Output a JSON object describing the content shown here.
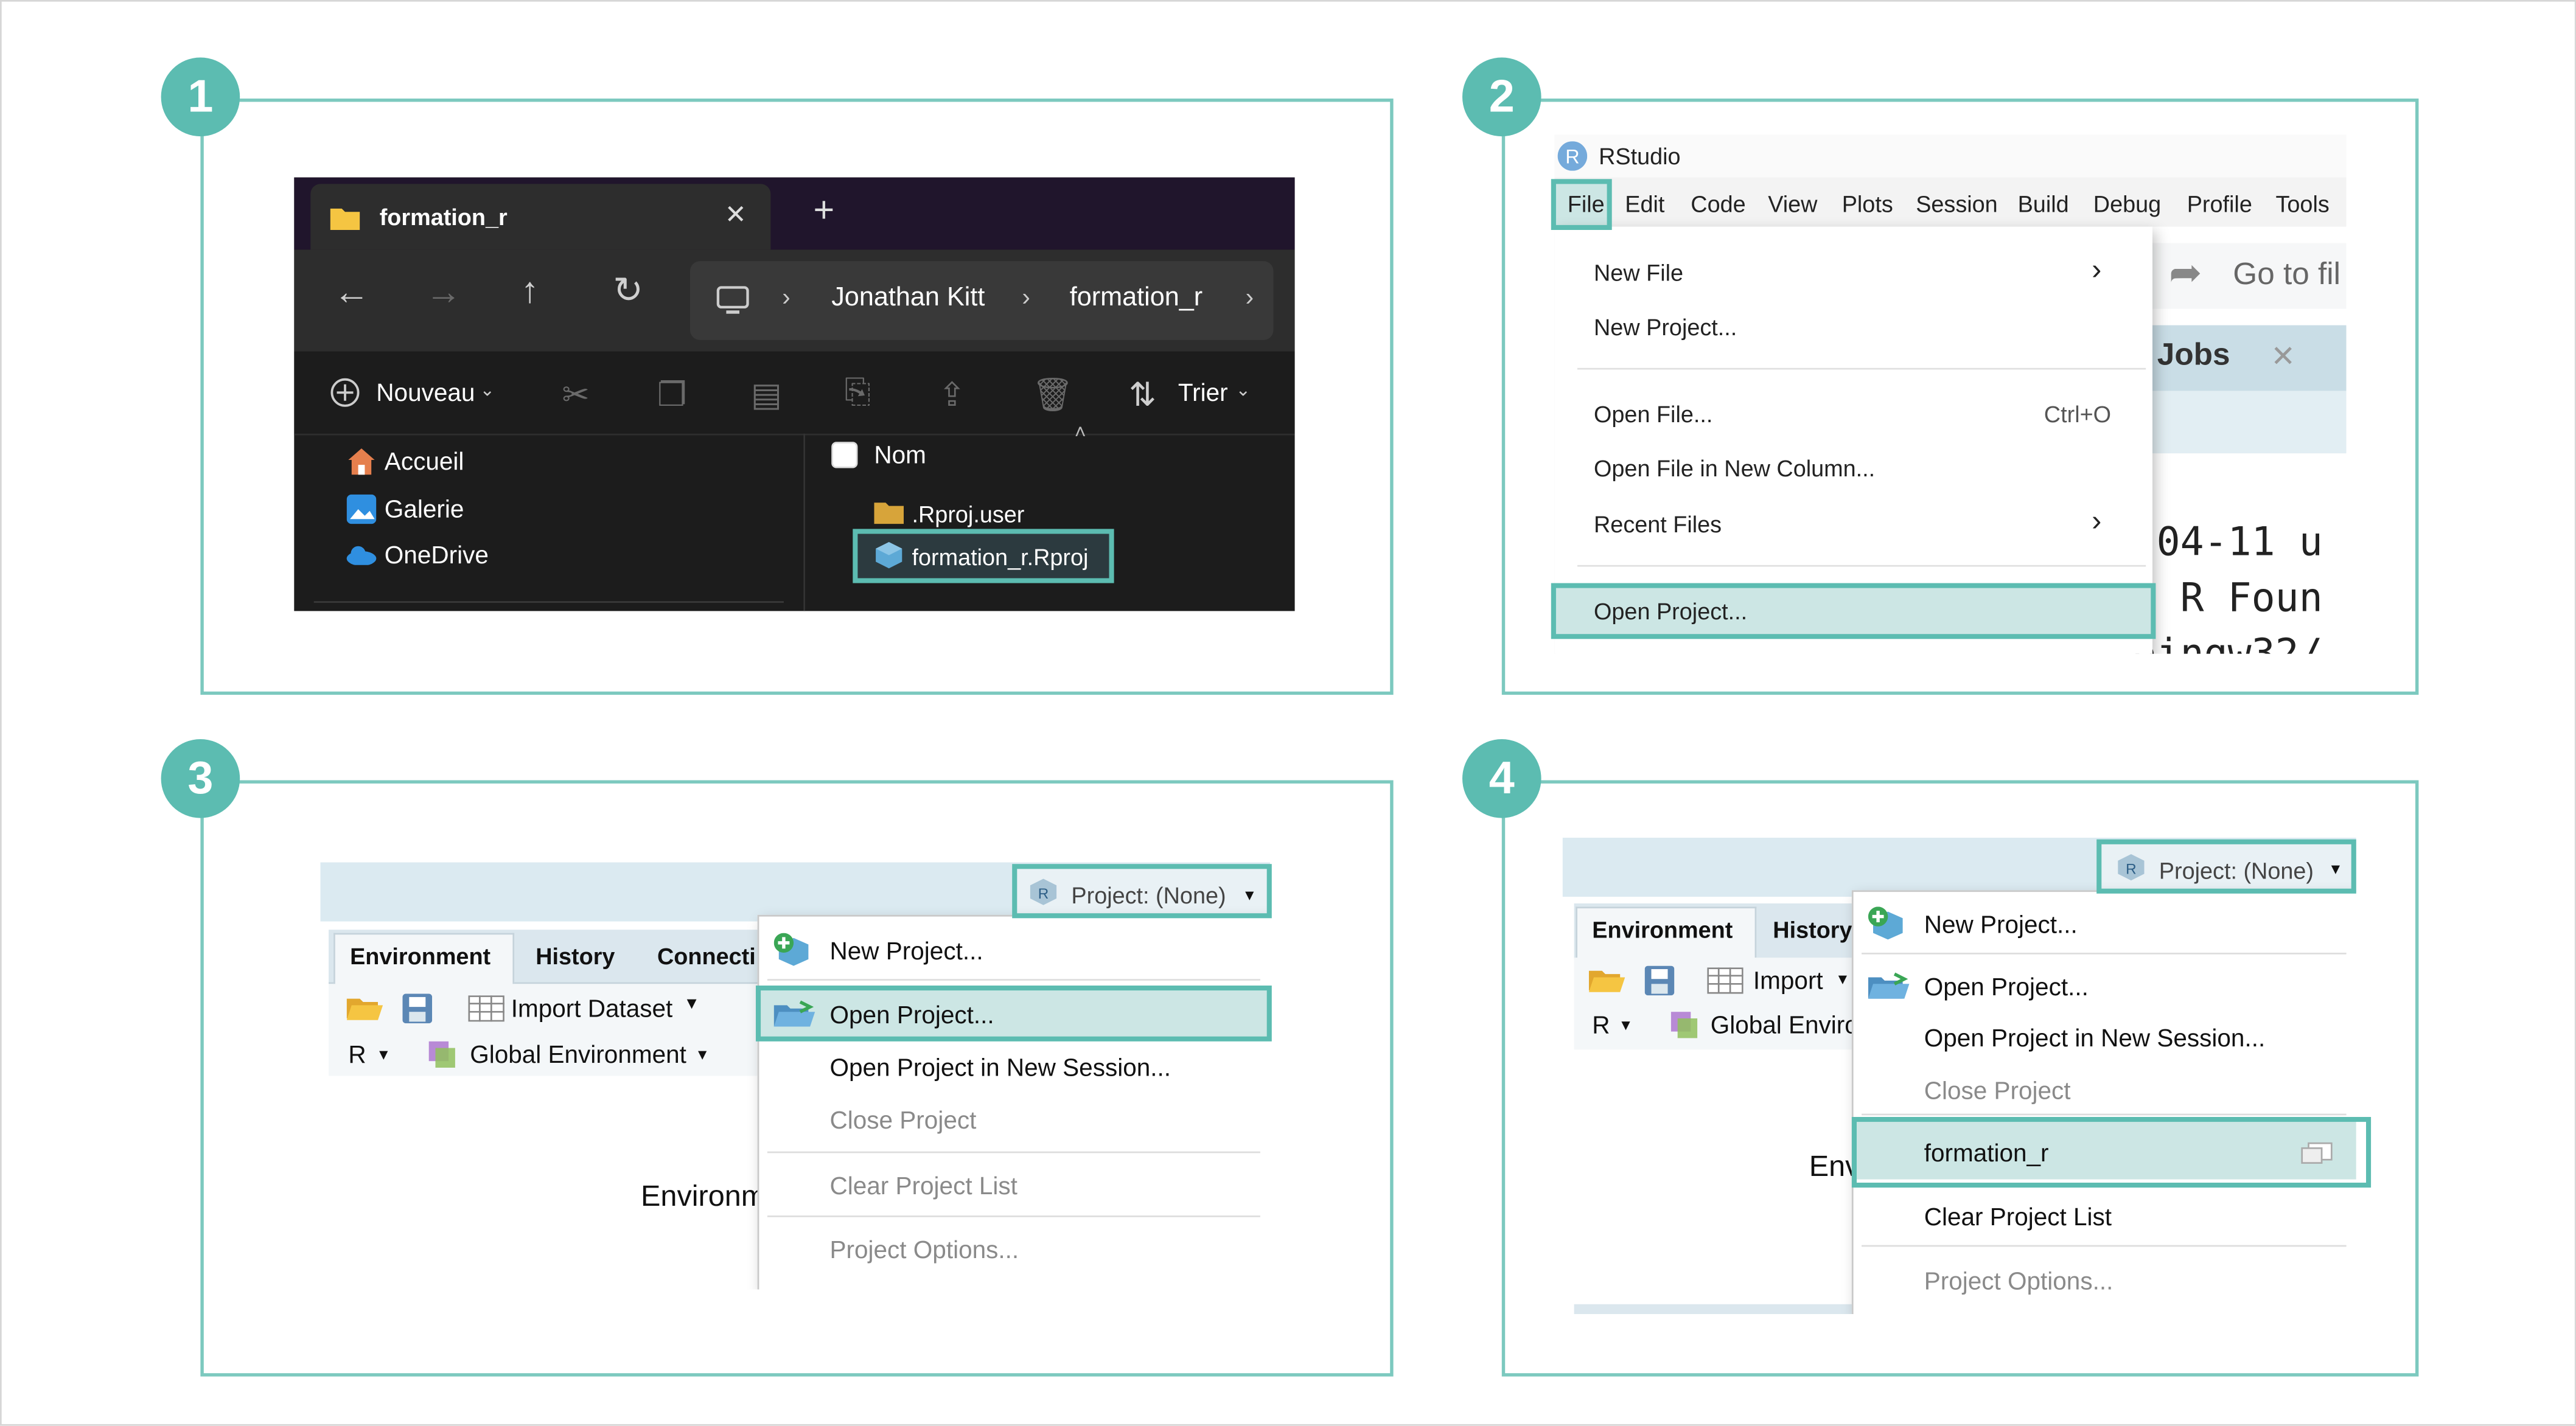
{
  "badges": [
    "1",
    "2",
    "3",
    "4"
  ],
  "step1": {
    "tab_title": "formation_r",
    "tab_close": "✕",
    "tab_new": "+",
    "breadcrumb": [
      "Jonathan Kitt",
      "formation_r"
    ],
    "toolbar": {
      "new_label": "Nouveau",
      "sort_label": "Trier"
    },
    "sidebar": [
      "Accueil",
      "Galerie",
      "OneDrive"
    ],
    "column_header": "Nom",
    "files": [
      ".Rproj.user",
      "formation_r.Rproj"
    ]
  },
  "step2": {
    "app_title": "RStudio",
    "menubar": [
      "File",
      "Edit",
      "Code",
      "View",
      "Plots",
      "Session",
      "Build",
      "Debug",
      "Profile",
      "Tools"
    ],
    "menu": {
      "new_file": "New File",
      "new_project": "New Project...",
      "open_file": "Open File...",
      "open_file_shortcut": "Ctrl+O",
      "open_file_new_column": "Open File in New Column...",
      "recent_files": "Recent Files",
      "open_project": "Open Project..."
    },
    "background": {
      "goto": "Go to fil",
      "jobs_tab": "d Jobs",
      "console": [
        "-04-11 u",
        "e R Foun",
        "oingw32/"
      ]
    }
  },
  "step3": {
    "project_button": "Project: (None)",
    "tabs": [
      "Environment",
      "History",
      "Connecti"
    ],
    "toolbar": {
      "import": "Import Dataset",
      "lang": "R",
      "env": "Global Environment"
    },
    "body_text": "Environm",
    "menu": {
      "new_project": "New Project...",
      "open_project": "Open Project...",
      "open_new_session": "Open Project in New Session...",
      "close_project": "Close Project",
      "clear_list": "Clear Project List",
      "options": "Project Options..."
    }
  },
  "step4": {
    "project_button": "Project: (None)",
    "tabs": [
      "Environment",
      "History"
    ],
    "toolbar": {
      "import": "Import",
      "lang": "R",
      "env": "Global Enviro"
    },
    "body_text": "Env",
    "menu": {
      "new_project": "New Project...",
      "open_project": "Open Project...",
      "open_new_session": "Open Project in New Session...",
      "close_project": "Close Project",
      "recent_project": "formation_r",
      "clear_list": "Clear Project List",
      "options": "Project Options..."
    }
  },
  "colors": {
    "accent": "#5cbcb1",
    "panel_border": "#7cc9bf",
    "rstudio_pane": "#dbeaf1",
    "menu_highlight": "#cce6e4"
  }
}
